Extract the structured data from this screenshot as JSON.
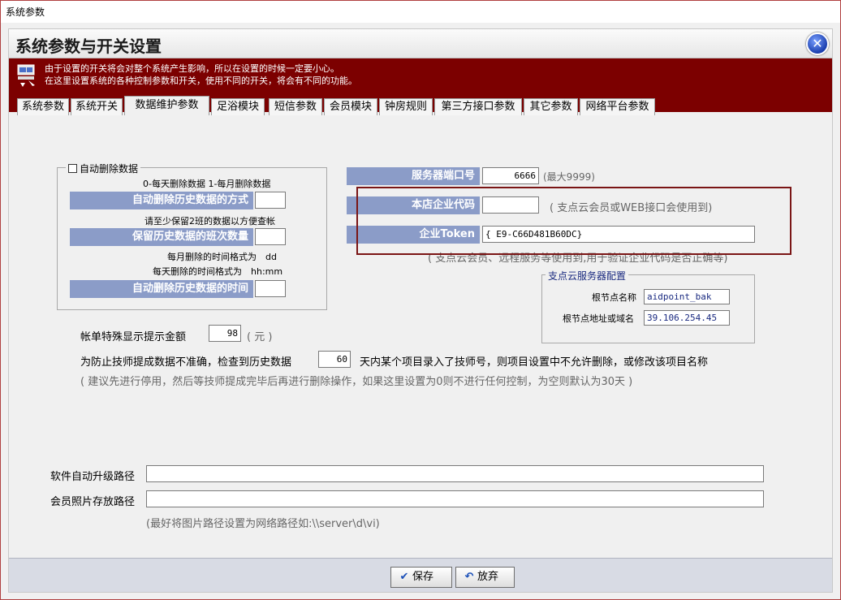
{
  "window": {
    "title": "系统参数"
  },
  "header": {
    "title": "系统参数与开关设置",
    "close_symbol": "✕"
  },
  "warning": {
    "line1": "由于设置的开关将会对整个系统产生影响，所以在设置的时候一定要小心。",
    "line2": "在这里设置系统的各种控制参数和开关，使用不同的开关，将会有不同的功能。"
  },
  "tabs": [
    {
      "label": "系统参数"
    },
    {
      "label": "系统开关"
    },
    {
      "label": "数据维护参数"
    },
    {
      "label": "足浴模块"
    },
    {
      "label": "短信参数"
    },
    {
      "label": "会员模块"
    },
    {
      "label": "钟房规则"
    },
    {
      "label": "第三方接口参数"
    },
    {
      "label": "其它参数"
    },
    {
      "label": "网络平台参数"
    }
  ],
  "auto_delete": {
    "legend": "自动删除数据",
    "mode_note": "0-每天删除数据 1-每月删除数据",
    "mode_label": "自动删除历史数据的方式",
    "mode_value": "",
    "keep_note": "请至少保留2班的数据以方便查帐",
    "keep_label": "保留历史数据的班次数量",
    "keep_value": "",
    "month_format_note": "每月删除的时间格式为　dd",
    "day_format_note": "每天删除的时间格式为　hh:mm",
    "time_label": "自动删除历史数据的时间",
    "time_value": ""
  },
  "server": {
    "port_label": "服务器端口号",
    "port_value": "6666",
    "port_note": "(最大9999)",
    "code_label": "本店企业代码",
    "code_value": "",
    "code_note": "( 支点云会员或WEB接口会使用到)",
    "token_label": "企业Token",
    "token_value": "{                    E9-C66D481B60DC}",
    "token_note": "( 支点云会员、远程服务等使用到,用于验证企业代码是否正确等)"
  },
  "cloud": {
    "legend": "支点云服务器配置",
    "root_name_label": "根节点名称",
    "root_name_value": "aidpoint_bak",
    "root_addr_label": "根节点地址或域名",
    "root_addr_value": "39.106.254.45"
  },
  "bill": {
    "label": "帐单特殊显示提示金额",
    "value": "98",
    "unit": "( 元 )"
  },
  "tech": {
    "label": "为防止技师提成数据不准确，检查到历史数据",
    "value": "60",
    "suffix": "天内某个项目录入了技师号，则项目设置中不允许删除，或修改该项目名称",
    "hint": "( 建议先进行停用，然后等技师提成完毕后再进行删除操作，如果这里设置为0则不进行任何控制，为空则默认为30天 )"
  },
  "paths": {
    "upgrade_label": "软件自动升级路径",
    "upgrade_value": "",
    "photo_label": "会员照片存放路径",
    "photo_value": "",
    "hint": "(最好将图片路径设置为网络路径如:\\\\server\\d\\vi)"
  },
  "buttons": {
    "save": "保存",
    "cancel": "放弃"
  },
  "colors": {
    "warning_bg": "#7c0000",
    "label_bar": "#8b9cc8",
    "highlight_box": "#7a1515"
  }
}
